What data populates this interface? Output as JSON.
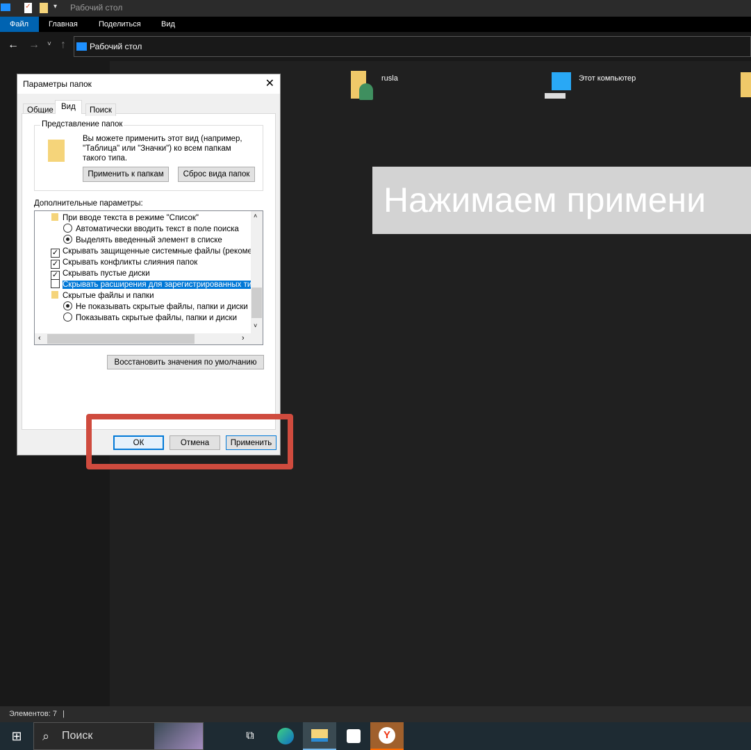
{
  "window": {
    "title": "Рабочий стол"
  },
  "ribbon": {
    "tabs": [
      "Файл",
      "Главная",
      "Поделиться",
      "Вид"
    ]
  },
  "address": {
    "path": "Рабочий стол"
  },
  "desktop_items": [
    {
      "label": "rusla"
    },
    {
      "label": "Этот компьютер"
    }
  ],
  "overlay": {
    "caption": "Нажимаем примени"
  },
  "status": {
    "items": "Элементов: 7"
  },
  "taskbar": {
    "search_placeholder": "Поиск"
  },
  "dialog": {
    "title": "Параметры папок",
    "tabs": [
      "Общие",
      "Вид",
      "Поиск"
    ],
    "group_title": "Представление папок",
    "group_text": "Вы можете применить этот вид (например, \"Таблица\" или \"Значки\") ко всем папкам такого типа.",
    "apply_folders": "Применить к папкам",
    "reset_folders": "Сброс вида папок",
    "advanced_label": "Дополнительные параметры:",
    "items": [
      {
        "type": "folder",
        "label": "При вводе текста в режиме \"Список\""
      },
      {
        "type": "radio",
        "checked": false,
        "label": "Автоматически вводить текст в поле поиска"
      },
      {
        "type": "radio",
        "checked": true,
        "label": "Выделять введенный элемент в списке"
      },
      {
        "type": "check",
        "checked": true,
        "label": "Скрывать защищенные системные файлы (рекомен,"
      },
      {
        "type": "check",
        "checked": true,
        "label": "Скрывать конфликты слияния папок"
      },
      {
        "type": "check",
        "checked": true,
        "label": "Скрывать пустые диски"
      },
      {
        "type": "check",
        "checked": false,
        "selected": true,
        "label": "Скрывать расширения для зарегистрированных типов"
      },
      {
        "type": "folder",
        "label": "Скрытые файлы и папки"
      },
      {
        "type": "radio",
        "checked": true,
        "label": "Не показывать скрытые файлы, папки и диски"
      },
      {
        "type": "radio",
        "checked": false,
        "label": "Показывать скрытые файлы, папки и диски"
      }
    ],
    "restore": "Восстановить значения по умолчанию",
    "ok": "ОК",
    "cancel": "Отмена",
    "apply": "Применить"
  }
}
